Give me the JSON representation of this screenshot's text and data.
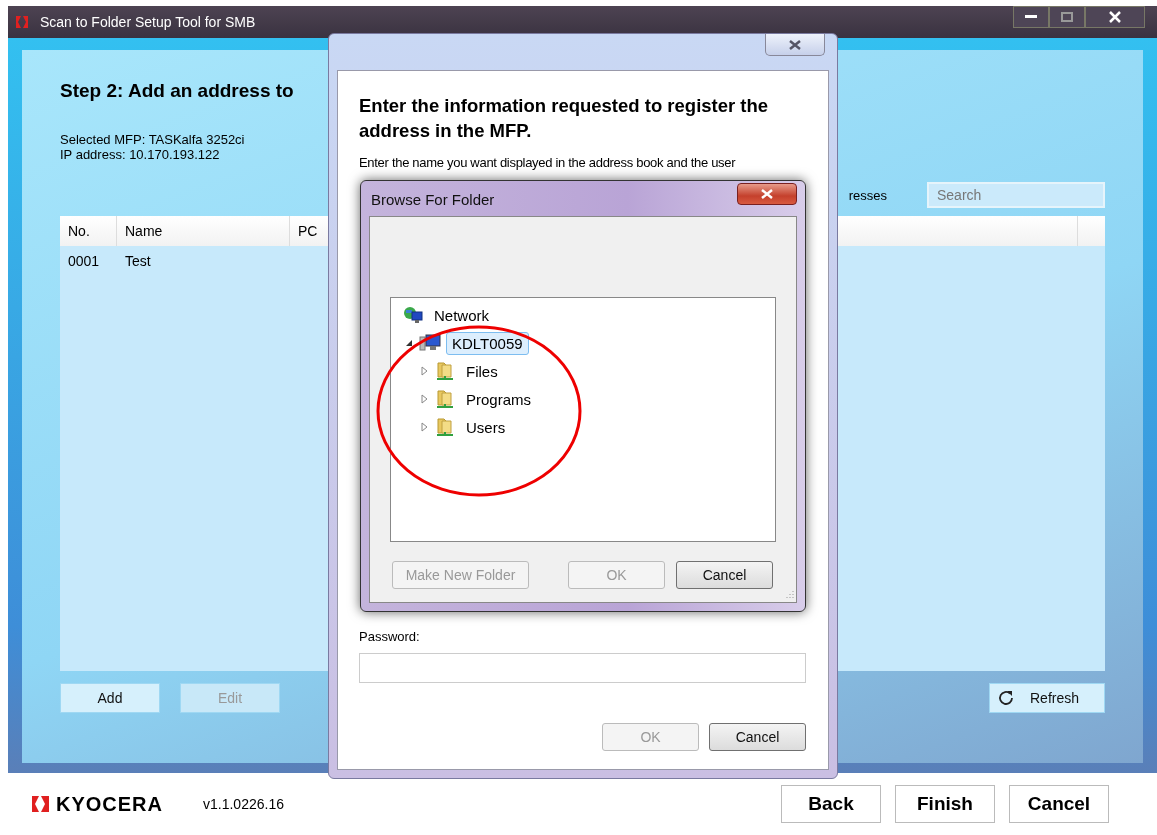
{
  "main_window": {
    "title": "Scan to Folder Setup Tool for SMB",
    "heading": "Step 2: Add an address to",
    "mfp_line": "Selected MFP: TASKalfa 3252ci",
    "ip_line": "IP address: 10.170.193.122",
    "list_label": "resses",
    "search": {
      "placeholder": "Search"
    },
    "table": {
      "columns": [
        "No.",
        "Name",
        "PC"
      ],
      "rows": [
        [
          "0001",
          "Test"
        ]
      ]
    },
    "buttons": [
      {
        "label": "Add",
        "disabled": false
      },
      {
        "label": "Edit",
        "disabled": true
      }
    ],
    "refresh_button": "Refresh",
    "logo_text": "KYOCERA",
    "version": "v1.1.0226.16",
    "footer_buttons": [
      "Back",
      "Finish",
      "Cancel"
    ]
  },
  "register_dialog": {
    "heading": "Enter the information requested to register the address in the MFP.",
    "instructions": "Enter the name you want displayed in the address book and the user",
    "password_label": "Password:",
    "buttons": [
      {
        "label": "OK",
        "disabled": true
      },
      {
        "label": "Cancel",
        "disabled": false
      }
    ]
  },
  "browse_dialog": {
    "title": "Browse For Folder",
    "tree": [
      {
        "label": "Network",
        "kind": "network",
        "selected": false,
        "children": [
          {
            "label": "KDLT0059",
            "kind": "computer",
            "selected": true,
            "expanded": true,
            "children": [
              {
                "label": "Files",
                "kind": "share",
                "selected": false,
                "expanded": false
              },
              {
                "label": "Programs",
                "kind": "share",
                "selected": false,
                "expanded": false
              },
              {
                "label": "Users",
                "kind": "share",
                "selected": false,
                "expanded": false
              }
            ]
          }
        ]
      }
    ],
    "buttons": [
      {
        "label": "Make New Folder",
        "disabled": true
      },
      {
        "label": "OK",
        "disabled": true
      },
      {
        "label": "Cancel",
        "disabled": false
      }
    ]
  }
}
